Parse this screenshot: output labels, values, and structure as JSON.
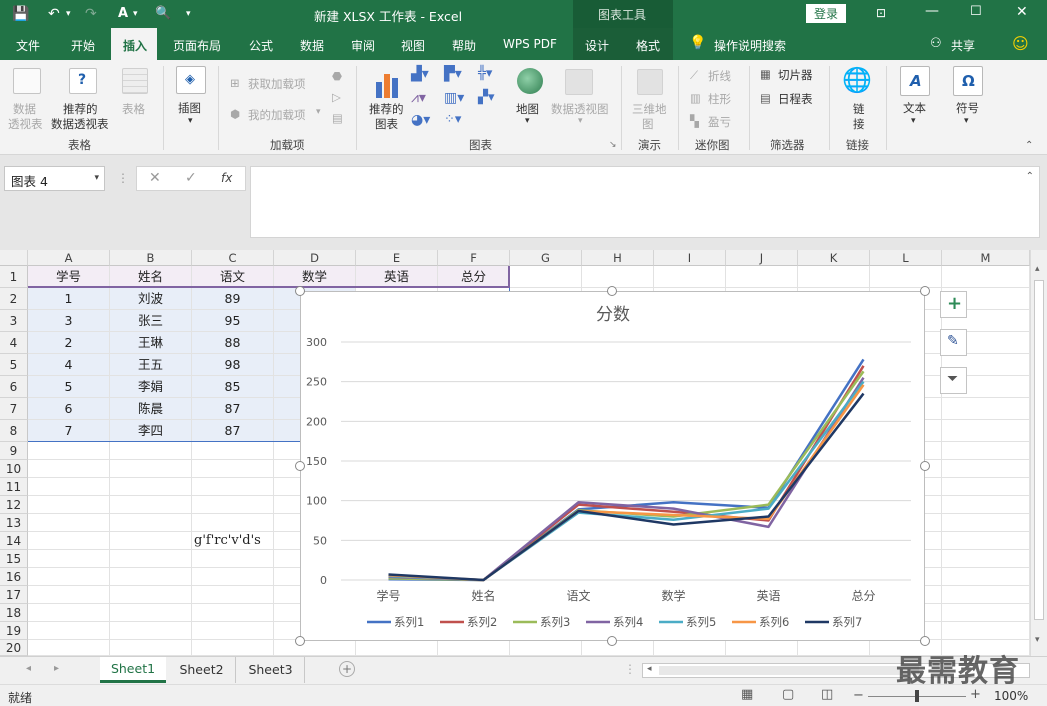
{
  "titlebar": {
    "doc_title": "新建 XLSX 工作表  -  Excel",
    "context_tool": "图表工具",
    "login": "登录"
  },
  "tabs": [
    "文件",
    "开始",
    "插入",
    "页面布局",
    "公式",
    "数据",
    "审阅",
    "视图",
    "帮助",
    "WPS PDF",
    "设计",
    "格式"
  ],
  "active_tab": "插入",
  "tell_me": "操作说明搜索",
  "share": "共享",
  "ribbon": {
    "groups": {
      "tables": "表格",
      "addins": "加载项",
      "charts": "图表",
      "tours": "演示",
      "sparklines": "迷你图",
      "filters": "筛选器",
      "links": "链接"
    },
    "pivot_line1": "数据",
    "pivot_line2": "透视表",
    "rec_pivot_line1": "推荐的",
    "rec_pivot_line2": "数据透视表",
    "table": "表格",
    "illustrations": "插图",
    "get_addins": "获取加载项",
    "my_addins": "我的加载项",
    "rec_charts_line1": "推荐的",
    "rec_charts_line2": "图表",
    "map": "地图",
    "pivot_chart": "数据透视图",
    "map3d_line1": "三维地",
    "map3d_line2": "图",
    "spark_line": "折线",
    "spark_col": "柱形",
    "spark_wl": "盈亏",
    "slicer": "切片器",
    "timeline": "日程表",
    "link_line1": "链",
    "link_line2": "接",
    "text": "文本",
    "symbol": "符号"
  },
  "formula_bar": {
    "name_box": "图表 4",
    "fx": "fx",
    "formula": ""
  },
  "columns": [
    "A",
    "B",
    "C",
    "D",
    "E",
    "F",
    "G",
    "H",
    "I",
    "J",
    "K",
    "L",
    "M"
  ],
  "rows": [
    "1",
    "2",
    "3",
    "4",
    "5",
    "6",
    "7",
    "8",
    "9",
    "10",
    "11",
    "12",
    "13",
    "14",
    "15",
    "16",
    "17",
    "18",
    "19",
    "20"
  ],
  "table": {
    "headers": [
      "学号",
      "姓名",
      "语文",
      "数学",
      "英语",
      "总分"
    ],
    "rows": [
      [
        "1",
        "刘波",
        "89"
      ],
      [
        "3",
        "张三",
        "95"
      ],
      [
        "2",
        "王琳",
        "88"
      ],
      [
        "4",
        "王五",
        "98"
      ],
      [
        "5",
        "李娟",
        "85"
      ],
      [
        "6",
        "陈晨",
        "87"
      ],
      [
        "7",
        "李四",
        "87"
      ]
    ]
  },
  "stray_text": "g'f'rc'v'd's",
  "chart_data": {
    "type": "line",
    "title": "分数",
    "categories": [
      "学号",
      "姓名",
      "语文",
      "数学",
      "英语",
      "总分"
    ],
    "ylim": [
      0,
      300
    ],
    "yticks": [
      0,
      50,
      100,
      150,
      200,
      250,
      300
    ],
    "grid": true,
    "legend_position": "bottom",
    "series": [
      {
        "name": "系列1",
        "color": "#4472c4",
        "values": [
          1,
          0,
          89,
          98,
          91,
          278
        ]
      },
      {
        "name": "系列2",
        "color": "#c0504d",
        "values": [
          3,
          0,
          95,
          86,
          75,
          270
        ]
      },
      {
        "name": "系列3",
        "color": "#9bbb59",
        "values": [
          2,
          0,
          88,
          80,
          95,
          263
        ]
      },
      {
        "name": "系列4",
        "color": "#8064a2",
        "values": [
          4,
          0,
          98,
          90,
          67,
          255
        ]
      },
      {
        "name": "系列5",
        "color": "#4bacc6",
        "values": [
          5,
          0,
          85,
          76,
          90,
          250
        ]
      },
      {
        "name": "系列6",
        "color": "#f79646",
        "values": [
          6,
          0,
          87,
          82,
          77,
          246
        ]
      },
      {
        "name": "系列7",
        "color": "#1f3864",
        "values": [
          7,
          0,
          87,
          70,
          80,
          235
        ]
      }
    ]
  },
  "sheets": [
    "Sheet1",
    "Sheet2",
    "Sheet3"
  ],
  "active_sheet": "Sheet1",
  "status": {
    "ready": "就绪",
    "zoom": "100%"
  },
  "watermark": "最需教育"
}
